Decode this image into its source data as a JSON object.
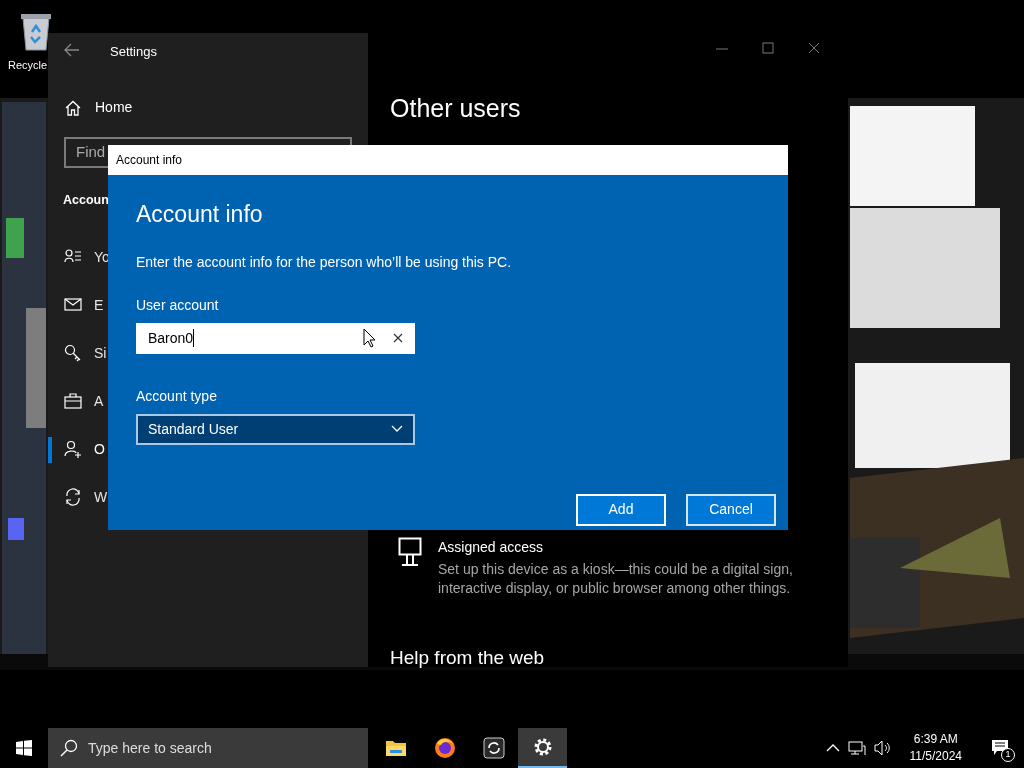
{
  "desktop": {
    "icons": [
      {
        "label": "Recycle",
        "kind": "recycle-bin"
      }
    ]
  },
  "settings_window": {
    "title": "Settings",
    "sidebar": {
      "home": "Home",
      "search": {
        "placeholder": "Find"
      },
      "section": "Accoun",
      "items": [
        {
          "label": "Yo",
          "kind": "person-list",
          "selected": false
        },
        {
          "label": "E",
          "kind": "mail",
          "selected": false
        },
        {
          "label": "Si",
          "kind": "key",
          "selected": false
        },
        {
          "label": "A",
          "kind": "briefcase",
          "selected": false
        },
        {
          "label": "O",
          "kind": "person-add",
          "selected": true
        },
        {
          "label": "W",
          "kind": "sync",
          "selected": false
        }
      ]
    },
    "page": {
      "title": "Other users",
      "options": [
        {
          "title": "Assigned access",
          "description": "Set up this device as a kiosk—this could be a digital sign, interactive display, or public browser among other things.",
          "kind": "kiosk"
        }
      ],
      "section": "Help from the web"
    }
  },
  "dialog": {
    "window_title": "Account info",
    "heading": "Account info",
    "intro": "Enter the account info for the person who’ll be using this PC.",
    "fields": [
      {
        "label": "User account",
        "kind": "text",
        "value": "Baron0"
      },
      {
        "label": "Account type",
        "kind": "select",
        "value": "Standard User"
      }
    ],
    "buttons": [
      {
        "label": "Add",
        "kind": "primary"
      },
      {
        "label": "Cancel",
        "kind": "secondary"
      }
    ]
  },
  "taskbar": {
    "search": {
      "placeholder": "Type here to search"
    },
    "apps": [
      {
        "kind": "folder",
        "selected": false
      },
      {
        "kind": "browser",
        "selected": false
      },
      {
        "kind": "sync-app",
        "selected": false
      },
      {
        "kind": "settings",
        "selected": true
      }
    ],
    "clock": {
      "time": "6:39 AM",
      "date": "11/5/2024"
    },
    "notifications": {
      "count": "1"
    }
  }
}
